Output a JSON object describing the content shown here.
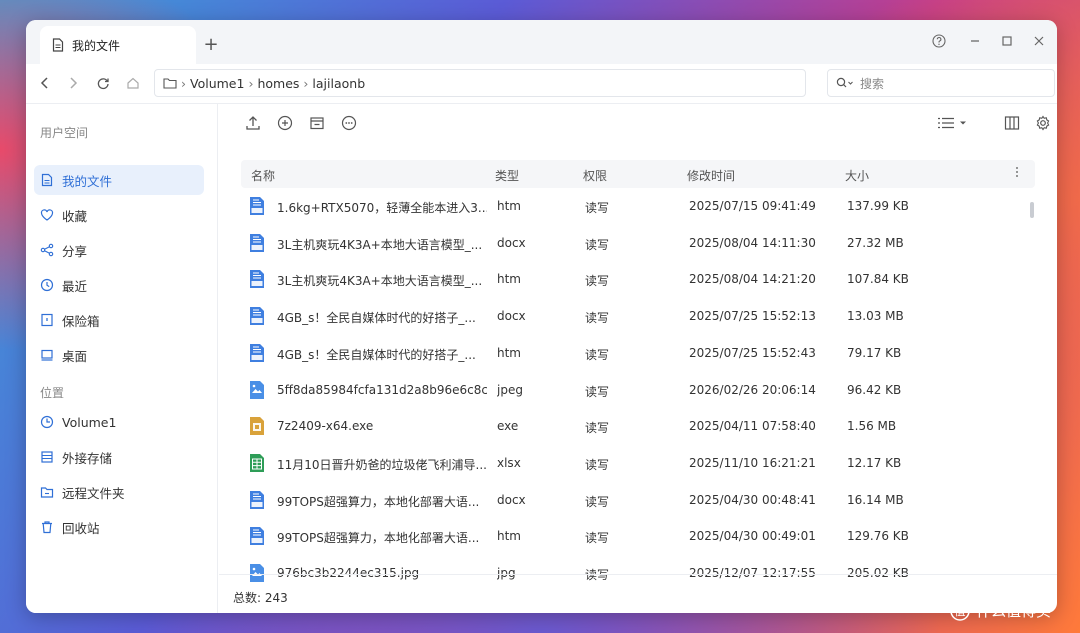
{
  "tab": {
    "label": "我的文件",
    "new_tab": "+"
  },
  "path": [
    "Volume1",
    "homes",
    "lajilaonb"
  ],
  "search": {
    "placeholder": "搜索"
  },
  "sidebar": {
    "section_user": "用户空间",
    "user_items": [
      {
        "label": "我的文件",
        "icon": "file-icon"
      },
      {
        "label": "收藏",
        "icon": "heart-icon"
      },
      {
        "label": "分享",
        "icon": "share-icon"
      },
      {
        "label": "最近",
        "icon": "clock-icon"
      },
      {
        "label": "保险箱",
        "icon": "safe-icon"
      },
      {
        "label": "桌面",
        "icon": "desktop-icon"
      }
    ],
    "section_location": "位置",
    "location_items": [
      {
        "label": "Volume1",
        "icon": "volume-icon"
      },
      {
        "label": "外接存储",
        "icon": "external-storage-icon"
      },
      {
        "label": "远程文件夹",
        "icon": "remote-folder-icon"
      },
      {
        "label": "回收站",
        "icon": "trash-icon"
      }
    ]
  },
  "table": {
    "headers": {
      "name": "名称",
      "type": "类型",
      "perm": "权限",
      "modified": "修改时间",
      "size": "大小"
    },
    "rows": [
      {
        "name": "1.6kg+RTX5070，轻薄全能本进入3...",
        "type": "htm",
        "perm": "读写",
        "modified": "2025/07/15 09:41:49",
        "size": "137.99 KB",
        "kind": "htm"
      },
      {
        "name": "3L主机爽玩4K3A+本地大语言模型_...",
        "type": "docx",
        "perm": "读写",
        "modified": "2025/08/04 14:11:30",
        "size": "27.32 MB",
        "kind": "docx"
      },
      {
        "name": "3L主机爽玩4K3A+本地大语言模型_...",
        "type": "htm",
        "perm": "读写",
        "modified": "2025/08/04 14:21:20",
        "size": "107.84 KB",
        "kind": "htm"
      },
      {
        "name": "4GB_s！全民自媒体时代的好搭子_...",
        "type": "docx",
        "perm": "读写",
        "modified": "2025/07/25 15:52:13",
        "size": "13.03 MB",
        "kind": "docx"
      },
      {
        "name": "4GB_s！全民自媒体时代的好搭子_...",
        "type": "htm",
        "perm": "读写",
        "modified": "2025/07/25 15:52:43",
        "size": "79.17 KB",
        "kind": "htm"
      },
      {
        "name": "5ff8da85984fcfa131d2a8b96e6c8c9...",
        "type": "jpeg",
        "perm": "读写",
        "modified": "2026/02/26 20:06:14",
        "size": "96.42 KB",
        "kind": "img"
      },
      {
        "name": "7z2409-x64.exe",
        "type": "exe",
        "perm": "读写",
        "modified": "2025/04/11 07:58:40",
        "size": "1.56 MB",
        "kind": "exe"
      },
      {
        "name": "11月10日晋升奶爸的垃圾佬飞利浦导...",
        "type": "xlsx",
        "perm": "读写",
        "modified": "2025/11/10 16:21:21",
        "size": "12.17 KB",
        "kind": "xlsx"
      },
      {
        "name": "99TOPS超强算力，本地化部署大语...",
        "type": "docx",
        "perm": "读写",
        "modified": "2025/04/30 00:48:41",
        "size": "16.14 MB",
        "kind": "docx"
      },
      {
        "name": "99TOPS超强算力，本地化部署大语...",
        "type": "htm",
        "perm": "读写",
        "modified": "2025/04/30 00:49:01",
        "size": "129.76 KB",
        "kind": "htm"
      },
      {
        "name": "976bc3b2244ec315.jpg",
        "type": "jpg",
        "perm": "读写",
        "modified": "2025/12/07 12:17:55",
        "size": "205.02 KB",
        "kind": "img"
      }
    ]
  },
  "footer": {
    "total": "总数: 243"
  },
  "watermark": "什么值得买",
  "colors": {
    "accent": "#2f6fd6",
    "active_bg": "#e8f0fc",
    "doc_blue": "#3f7fe0",
    "xlsx_green": "#2e9d57",
    "exe_amber": "#d9a23a"
  }
}
